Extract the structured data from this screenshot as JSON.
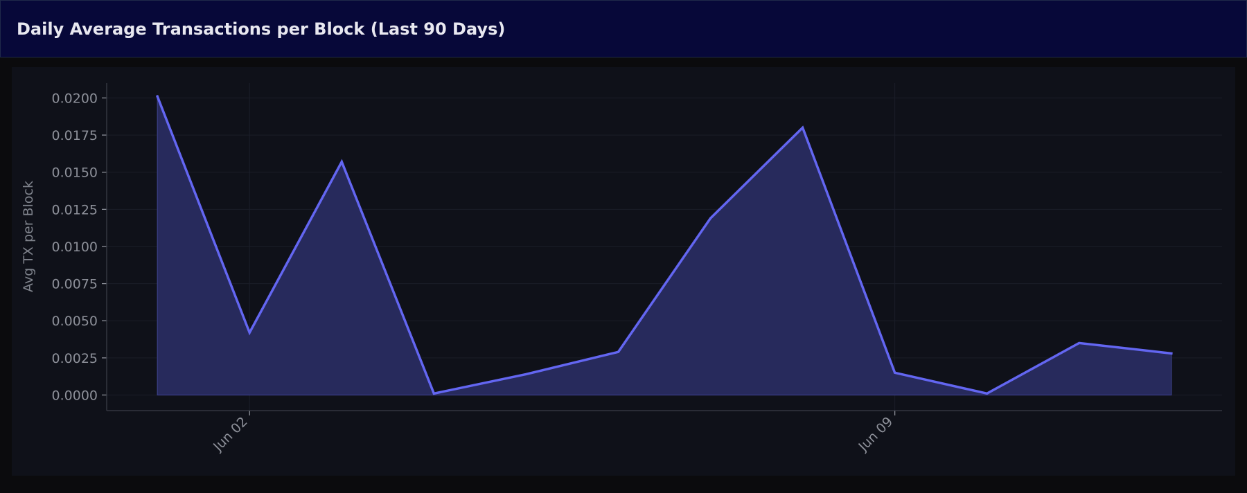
{
  "header": {
    "title": "Daily Average Transactions per Block (Last 90 Days)"
  },
  "colors": {
    "line": "#6366f1",
    "fill": "#272a5c",
    "background": "#0f1119",
    "header_bg": "#070839"
  },
  "chart_data": {
    "type": "area",
    "title": "Daily Average Transactions per Block (Last 90 Days)",
    "xlabel": "",
    "ylabel": "Avg TX per Block",
    "x_tick_labels": [
      "Jun 02",
      "Jun 09"
    ],
    "y_tick_labels": [
      "0.0000",
      "0.0025",
      "0.0050",
      "0.0075",
      "0.0100",
      "0.0125",
      "0.0150",
      "0.0175",
      "0.0200"
    ],
    "x": [
      "2024-06-01",
      "2024-06-02",
      "2024-06-03",
      "2024-06-04",
      "2024-06-05",
      "2024-06-06",
      "2024-06-07",
      "2024-06-08",
      "2024-06-09",
      "2024-06-10",
      "2024-06-11",
      "2024-06-12"
    ],
    "series": [
      {
        "values": [
          0.0201,
          0.0042,
          0.0157,
          0.0001,
          0.0014,
          0.0029,
          0.0119,
          0.018,
          0.0015,
          0.0001,
          0.0035,
          0.0028
        ]
      }
    ],
    "ylim": [
      -0.00105,
      0.021
    ],
    "grid": true,
    "legend": false
  }
}
